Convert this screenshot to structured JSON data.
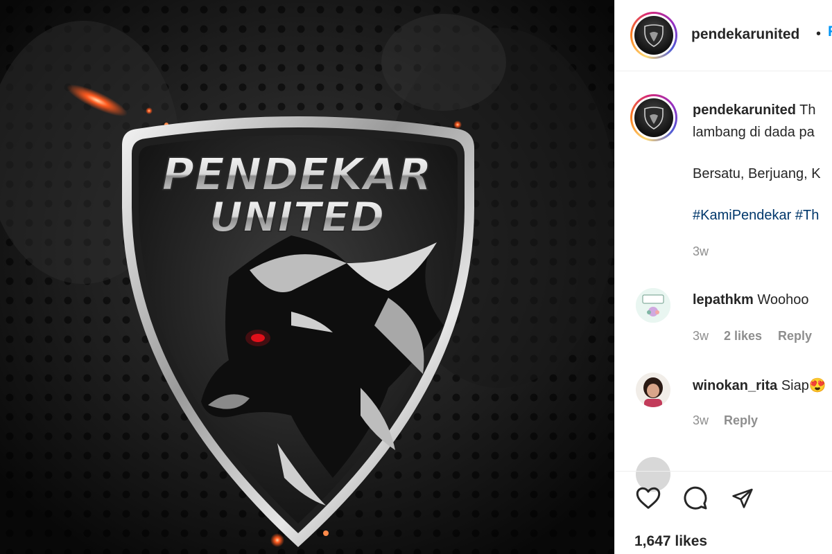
{
  "post": {
    "logo_line1": "PENDEKAR",
    "logo_line2": "UNITED",
    "colors": {
      "background": "#0c0c0c",
      "shield_rim": "#c8c8c8",
      "eye": "#e0101a",
      "spark": "#ff5a1f"
    }
  },
  "header": {
    "username": "pendekarunited",
    "separator": "•",
    "follow_partial": "F"
  },
  "caption": {
    "username": "pendekarunited",
    "line1": "Th",
    "line2": "lambang di dada pa",
    "line3": "Bersatu, Berjuang, K",
    "hashtags": "#KamiPendekar #Th",
    "time": "3w"
  },
  "comments": [
    {
      "username": "lepathkm",
      "text": "Woohoo",
      "time": "3w",
      "likes": "2 likes",
      "reply": "Reply"
    },
    {
      "username": "winokan_rita",
      "text": "Siap",
      "emoji": "😍",
      "time": "3w",
      "reply": "Reply"
    }
  ],
  "actions": {
    "like_icon": "heart-icon",
    "comment_icon": "comment-icon",
    "share_icon": "paper-plane-icon",
    "likes_count": "1,647 likes"
  }
}
